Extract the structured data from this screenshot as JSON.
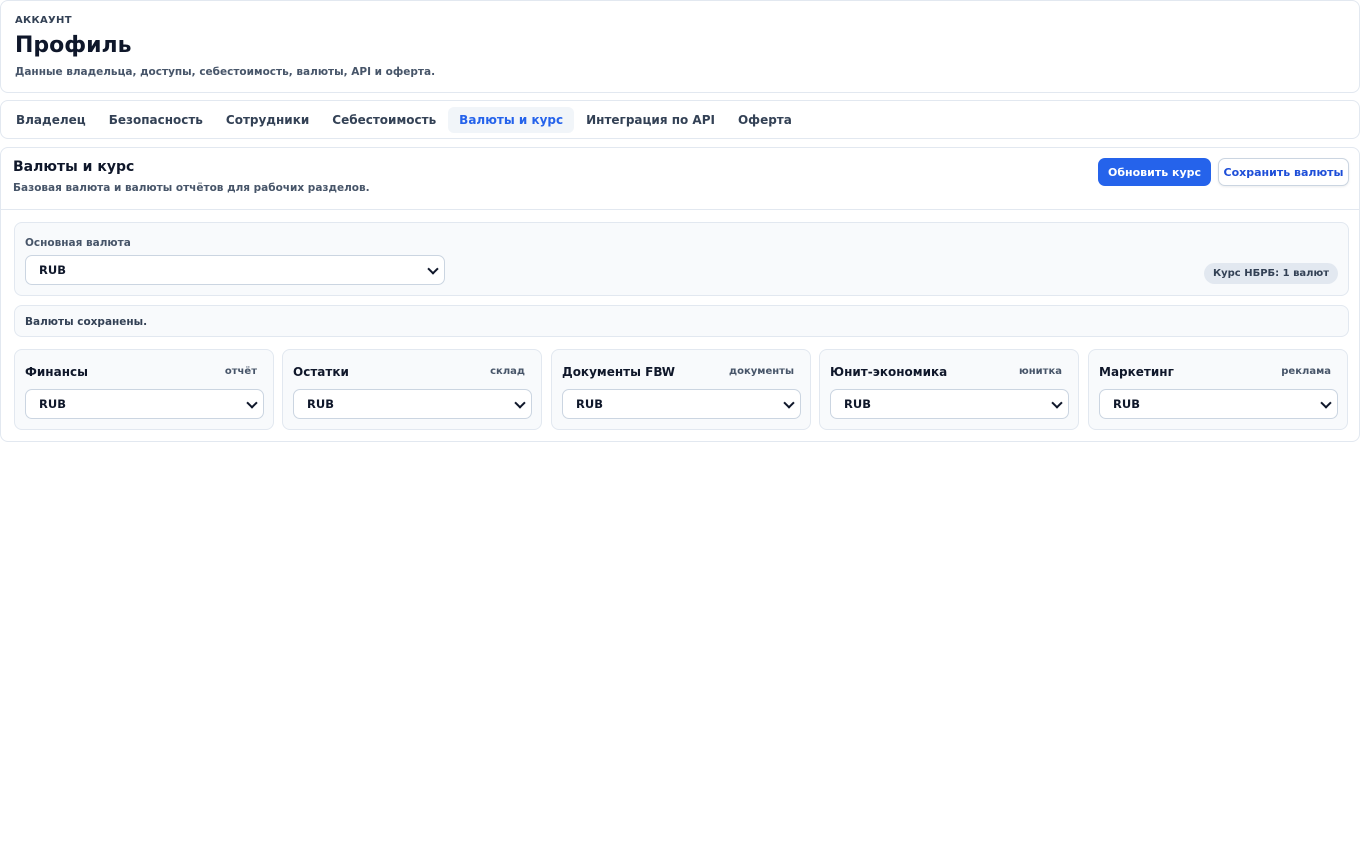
{
  "header": {
    "eyebrow": "АККАУНТ",
    "title": "Профиль",
    "subtitle": "Данные владельца, доступы, себестоимость, валюты, API и оферта."
  },
  "tabs": [
    {
      "label": "Владелец"
    },
    {
      "label": "Безопасность"
    },
    {
      "label": "Сотрудники"
    },
    {
      "label": "Себестоимость"
    },
    {
      "label": "Валюты и курс",
      "active": true
    },
    {
      "label": "Интеграция по API"
    },
    {
      "label": "Оферта"
    }
  ],
  "section": {
    "title": "Валюты и курс",
    "subtitle": "Базовая валюта и валюты отчётов для рабочих разделов.",
    "refresh_button": "Обновить курс",
    "save_button": "Сохранить валюты"
  },
  "main_currency": {
    "label": "Основная валюта",
    "value": "RUB",
    "rate_badge": "Курс НБРБ: 1 валют"
  },
  "status": {
    "message": "Валюты сохранены."
  },
  "currency_cards": [
    {
      "name": "Финансы",
      "tag": "отчёт",
      "value": "RUB"
    },
    {
      "name": "Остатки",
      "tag": "склад",
      "value": "RUB"
    },
    {
      "name": "Документы FBW",
      "tag": "документы",
      "value": "RUB"
    },
    {
      "name": "Юнит-экономика",
      "tag": "юнитка",
      "value": "RUB"
    },
    {
      "name": "Маркетинг",
      "tag": "реклама",
      "value": "RUB"
    }
  ],
  "colors": {
    "accent": "#2563eb",
    "border": "#e2e8f0",
    "panel_bg": "#f8fafc"
  }
}
